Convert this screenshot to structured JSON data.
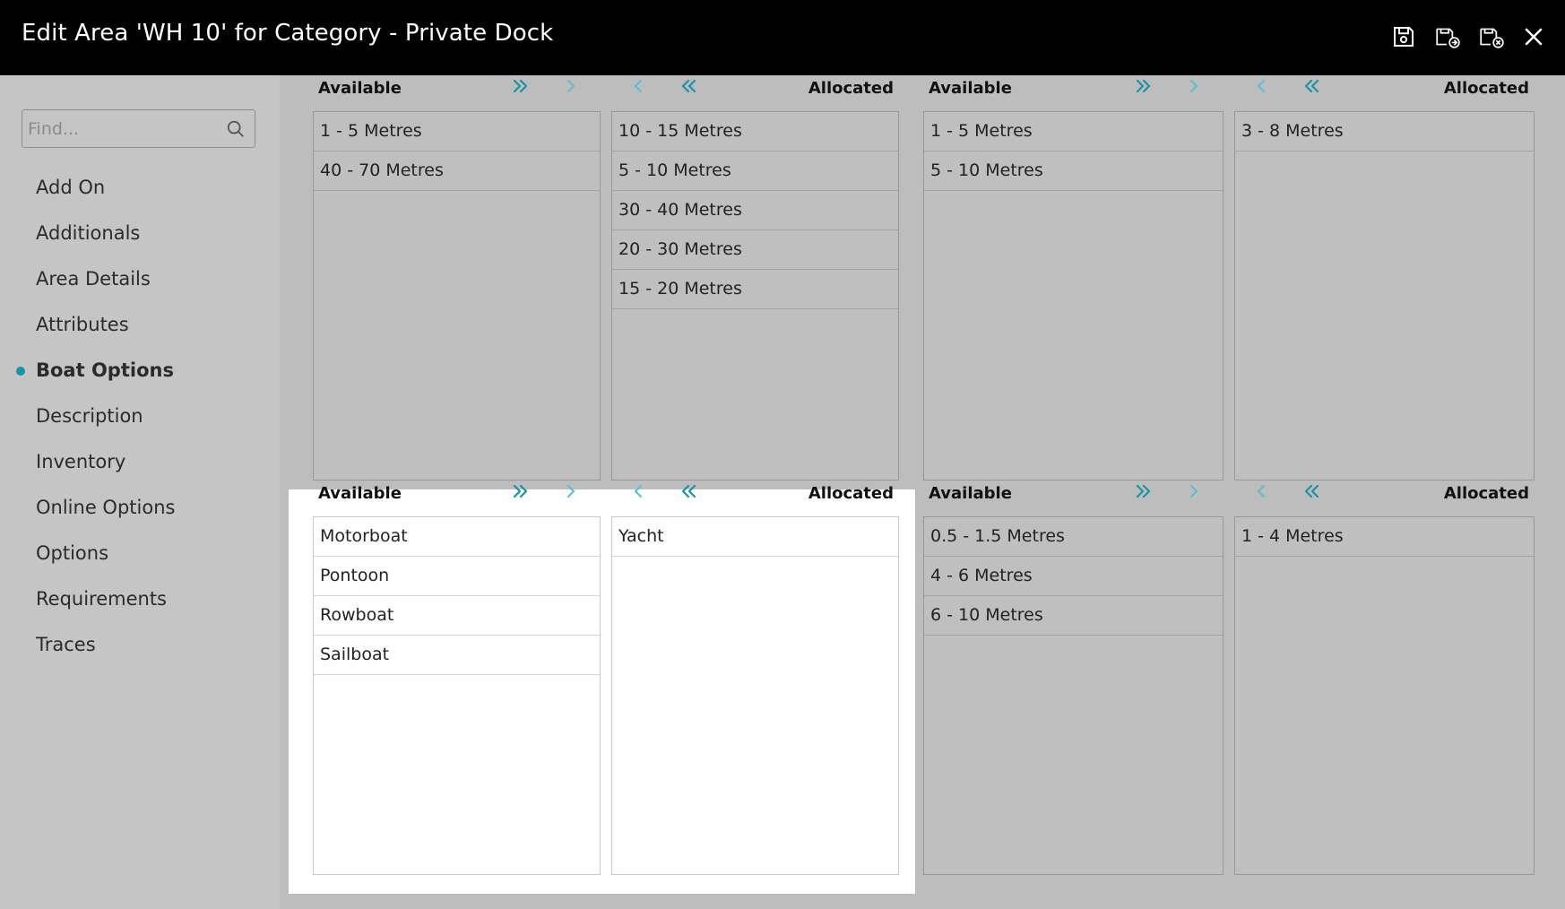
{
  "window": {
    "title": "Edit Area 'WH 10' for Category - Private Dock",
    "icons": [
      "save-icon",
      "save-and-new-icon",
      "save-and-close-icon",
      "close-icon"
    ]
  },
  "sidebar": {
    "search_placeholder": "Find...",
    "items": [
      {
        "label": "Add On",
        "active": false
      },
      {
        "label": "Additionals",
        "active": false
      },
      {
        "label": "Area Details",
        "active": false
      },
      {
        "label": "Attributes",
        "active": false
      },
      {
        "label": "Boat Options",
        "active": true
      },
      {
        "label": "Description",
        "active": false
      },
      {
        "label": "Inventory",
        "active": false
      },
      {
        "label": "Online Options",
        "active": false
      },
      {
        "label": "Options",
        "active": false
      },
      {
        "label": "Requirements",
        "active": false
      },
      {
        "label": "Traces",
        "active": false
      }
    ]
  },
  "panels": [
    {
      "available_label": "Available",
      "allocated_label": "Allocated",
      "available": [
        "1 - 5 Metres",
        "40 - 70 Metres"
      ],
      "allocated": [
        "10 - 15 Metres",
        "5 - 10 Metres",
        "30 - 40 Metres",
        "20 - 30 Metres",
        "15 - 20 Metres"
      ]
    },
    {
      "available_label": "Available",
      "allocated_label": "Allocated",
      "available": [
        "1 - 5 Metres",
        "5 - 10 Metres"
      ],
      "allocated": [
        "3 - 8 Metres"
      ]
    },
    {
      "available_label": "Available",
      "allocated_label": "Allocated",
      "available": [
        "Motorboat",
        "Pontoon",
        "Rowboat",
        "Sailboat"
      ],
      "allocated": [
        "Yacht"
      ]
    },
    {
      "available_label": "Available",
      "allocated_label": "Allocated",
      "available": [
        "0.5 - 1.5 Metres",
        "4 - 6 Metres",
        "6 - 10 Metres"
      ],
      "allocated": [
        "1 - 4 Metres"
      ]
    }
  ],
  "colors": {
    "accent": "#1a93a6",
    "titlebar": "#000000",
    "background": "#bdbdbd",
    "selected_panel": "#ffffff"
  }
}
